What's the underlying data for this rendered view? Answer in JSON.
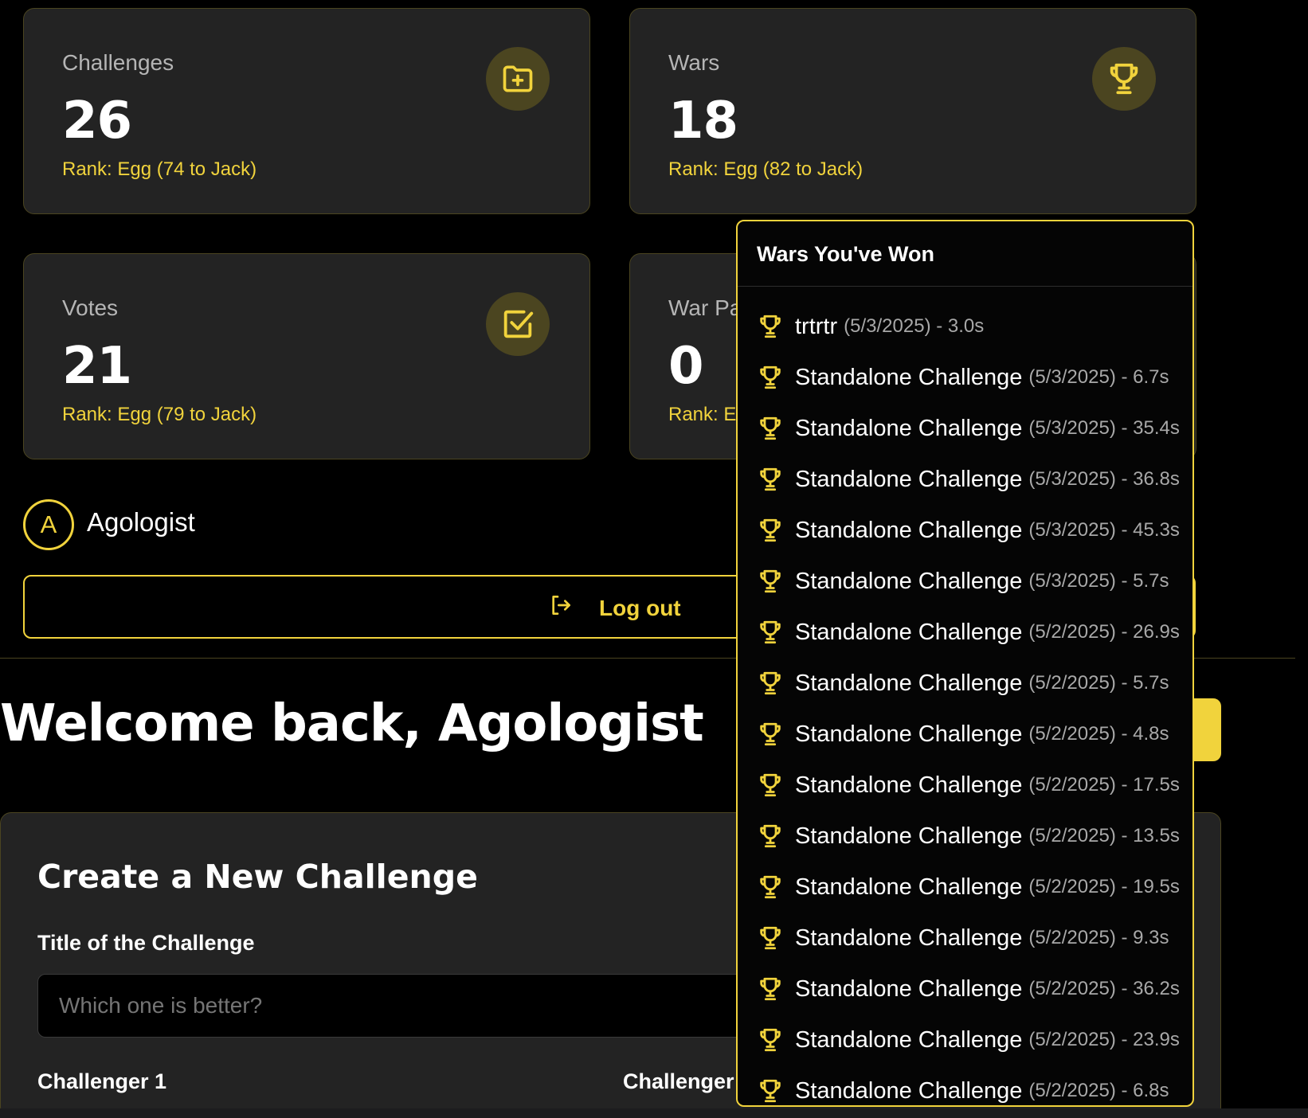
{
  "stats": [
    {
      "label": "Challenges",
      "value": "26",
      "rank": "Rank: Egg (74 to Jack)",
      "icon": "folder-plus-icon"
    },
    {
      "label": "Wars",
      "value": "18",
      "rank": "Rank: Egg (82 to Jack)",
      "icon": "trophy-icon"
    },
    {
      "label": "Votes",
      "value": "21",
      "rank": "Rank: Egg (79 to Jack)",
      "icon": "checkbox-icon"
    },
    {
      "label": "War Pa",
      "value": "0",
      "rank": "Rank: Eg"
    }
  ],
  "user": {
    "initial": "A",
    "name": "Agologist"
  },
  "logout": {
    "label": "Log out",
    "icon": "logout-icon"
  },
  "welcome": {
    "title": "Welcome back, Agologist"
  },
  "create_form": {
    "title": "Create a New Challenge",
    "title_label": "Title of the Challenge",
    "title_placeholder": "Which one is better?",
    "challenger1_label": "Challenger 1",
    "challenger2_label": "Challenger"
  },
  "wars_popup": {
    "title": "Wars You've Won",
    "items": [
      {
        "name": "trtrtr",
        "meta": "(5/3/2025) - 3.0s"
      },
      {
        "name": "Standalone Challenge",
        "meta": "(5/3/2025) - 6.7s"
      },
      {
        "name": "Standalone Challenge",
        "meta": "(5/3/2025) - 35.4s"
      },
      {
        "name": "Standalone Challenge",
        "meta": "(5/3/2025) - 36.8s"
      },
      {
        "name": "Standalone Challenge",
        "meta": "(5/3/2025) - 45.3s"
      },
      {
        "name": "Standalone Challenge",
        "meta": "(5/3/2025) - 5.7s"
      },
      {
        "name": "Standalone Challenge",
        "meta": "(5/2/2025) - 26.9s"
      },
      {
        "name": "Standalone Challenge",
        "meta": "(5/2/2025) - 5.7s"
      },
      {
        "name": "Standalone Challenge",
        "meta": "(5/2/2025) - 4.8s"
      },
      {
        "name": "Standalone Challenge",
        "meta": "(5/2/2025) - 17.5s"
      },
      {
        "name": "Standalone Challenge",
        "meta": "(5/2/2025) - 13.5s"
      },
      {
        "name": "Standalone Challenge",
        "meta": "(5/2/2025) - 19.5s"
      },
      {
        "name": "Standalone Challenge",
        "meta": "(5/2/2025) - 9.3s"
      },
      {
        "name": "Standalone Challenge",
        "meta": "(5/2/2025) - 36.2s"
      },
      {
        "name": "Standalone Challenge",
        "meta": "(5/2/2025) - 23.9s"
      },
      {
        "name": "Standalone Challenge",
        "meta": "(5/2/2025) - 6.8s"
      }
    ]
  },
  "colors": {
    "accent": "#f1d33c",
    "card_bg": "#232323",
    "page_bg": "#000000",
    "badge_bg": "#4b4520"
  }
}
